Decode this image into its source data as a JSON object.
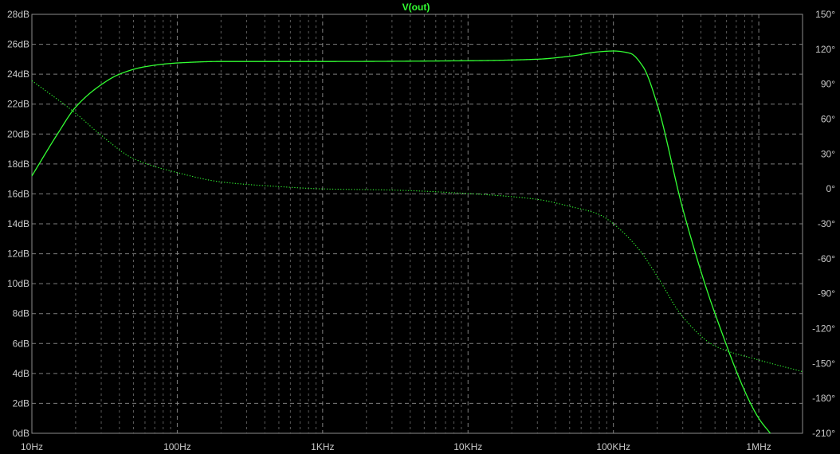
{
  "chart_data": {
    "type": "line",
    "title": "V(out)",
    "x_scale": "log",
    "xlim": [
      10,
      2000000
    ],
    "y_left_lim": [
      0,
      28
    ],
    "y_right_lim": [
      -210,
      150
    ],
    "grid": true,
    "x_ticks": [
      {
        "value": 10,
        "label": "10Hz"
      },
      {
        "value": 100,
        "label": "100Hz"
      },
      {
        "value": 1000,
        "label": "1KHz"
      },
      {
        "value": 10000,
        "label": "10KHz"
      },
      {
        "value": 100000,
        "label": "100KHz"
      },
      {
        "value": 1000000,
        "label": "1MHz"
      }
    ],
    "y_left_ticks": [
      {
        "value": 0,
        "label": "0dB"
      },
      {
        "value": 2,
        "label": "2dB"
      },
      {
        "value": 4,
        "label": "4dB"
      },
      {
        "value": 6,
        "label": "6dB"
      },
      {
        "value": 8,
        "label": "8dB"
      },
      {
        "value": 10,
        "label": "10dB"
      },
      {
        "value": 12,
        "label": "12dB"
      },
      {
        "value": 14,
        "label": "14dB"
      },
      {
        "value": 16,
        "label": "16dB"
      },
      {
        "value": 18,
        "label": "18dB"
      },
      {
        "value": 20,
        "label": "20dB"
      },
      {
        "value": 22,
        "label": "22dB"
      },
      {
        "value": 24,
        "label": "24dB"
      },
      {
        "value": 26,
        "label": "26dB"
      },
      {
        "value": 28,
        "label": "28dB"
      }
    ],
    "y_right_ticks": [
      {
        "value": -210,
        "label": "-210°"
      },
      {
        "value": -180,
        "label": "-180°"
      },
      {
        "value": -150,
        "label": "-150°"
      },
      {
        "value": -120,
        "label": "-120°"
      },
      {
        "value": -90,
        "label": "-90°"
      },
      {
        "value": -60,
        "label": "-60°"
      },
      {
        "value": -30,
        "label": "-30°"
      },
      {
        "value": 0,
        "label": "0°"
      },
      {
        "value": 30,
        "label": "30°"
      },
      {
        "value": 60,
        "label": "60°"
      },
      {
        "value": 90,
        "label": "90°"
      },
      {
        "value": 120,
        "label": "120°"
      },
      {
        "value": 150,
        "label": "150°"
      }
    ],
    "series": [
      {
        "axis": "left",
        "style": "solid",
        "x": [
          10,
          15,
          20,
          30,
          40,
          60,
          100,
          200,
          1000,
          10000,
          30000,
          50000,
          80000,
          100000,
          130000,
          160000,
          200000,
          300000,
          500000,
          1000000,
          1200000
        ],
        "y": [
          17.2,
          20.0,
          21.8,
          23.3,
          24.0,
          24.5,
          24.75,
          24.85,
          24.85,
          24.9,
          25.0,
          25.2,
          25.5,
          25.55,
          25.4,
          24.5,
          22.0,
          15.0,
          8.0,
          1.0,
          0.0
        ]
      },
      {
        "axis": "right",
        "style": "dotted",
        "x": [
          10,
          20,
          30,
          50,
          100,
          200,
          500,
          1000,
          3000,
          10000,
          30000,
          50000,
          80000,
          100000,
          150000,
          200000,
          300000,
          500000,
          1000000,
          2000000
        ],
        "y": [
          93,
          65,
          46,
          26,
          14,
          6,
          2,
          0,
          -1,
          -4,
          -9,
          -15,
          -22,
          -30,
          -52,
          -75,
          -110,
          -135,
          -147,
          -157
        ]
      }
    ],
    "line_color": "#33ff33",
    "grid_color": "#8c8c8c",
    "background": "#000000"
  }
}
